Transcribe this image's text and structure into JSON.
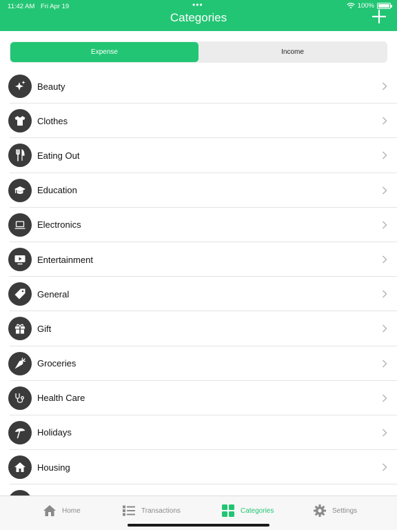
{
  "status_bar": {
    "time": "11:42 AM",
    "date": "Fri Apr 19",
    "battery": "100%",
    "dots": "•••"
  },
  "header": {
    "title": "Categories"
  },
  "segments": {
    "expense": "Expense",
    "income": "Income",
    "selected": "Expense"
  },
  "categories": [
    {
      "label": "Beauty",
      "icon": "sparkles-icon"
    },
    {
      "label": "Clothes",
      "icon": "tshirt-icon"
    },
    {
      "label": "Eating Out",
      "icon": "fork-knife-icon"
    },
    {
      "label": "Education",
      "icon": "graduation-cap-icon"
    },
    {
      "label": "Electronics",
      "icon": "laptop-icon"
    },
    {
      "label": "Entertainment",
      "icon": "tv-play-icon"
    },
    {
      "label": "General",
      "icon": "tag-icon"
    },
    {
      "label": "Gift",
      "icon": "gift-icon"
    },
    {
      "label": "Groceries",
      "icon": "carrot-icon"
    },
    {
      "label": "Health Care",
      "icon": "stethoscope-icon"
    },
    {
      "label": "Holidays",
      "icon": "beach-umbrella-icon"
    },
    {
      "label": "Housing",
      "icon": "house-icon"
    }
  ],
  "tabbar": {
    "home": "Home",
    "transactions": "Transactions",
    "categories": "Categories",
    "settings": "Settings",
    "active": "Categories"
  },
  "colors": {
    "accent": "#22c573",
    "icon_bg": "#3b3b3b",
    "inactive": "#8a8a8a"
  }
}
